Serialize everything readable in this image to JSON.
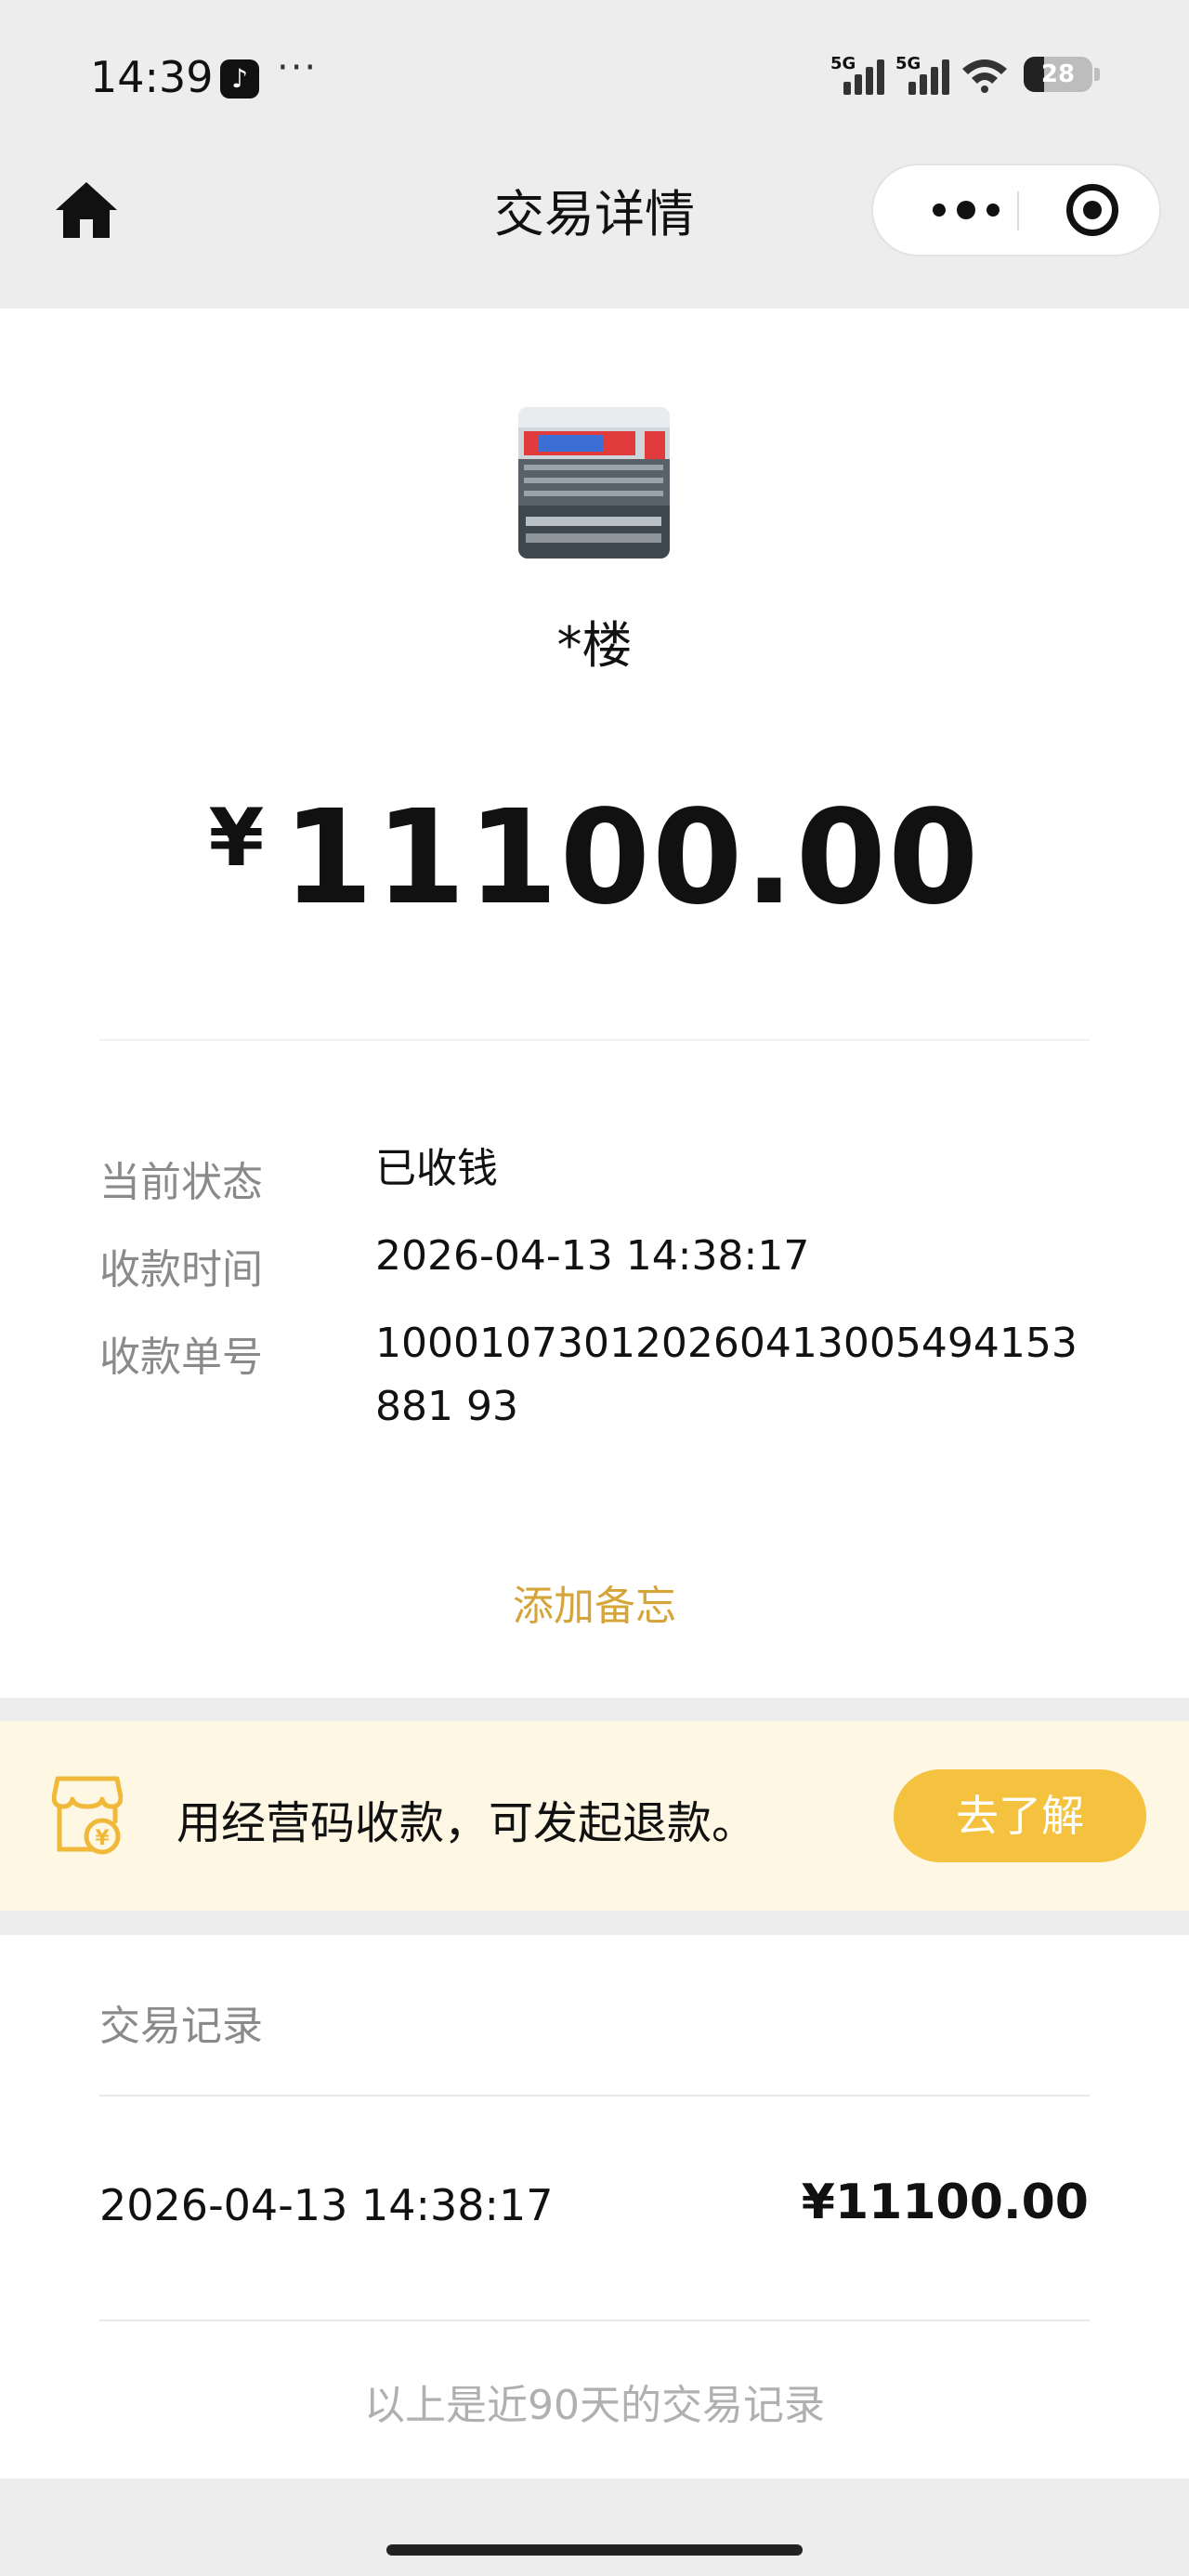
{
  "status_bar": {
    "time": "14:39",
    "app_icon": "tiktok-icon",
    "more_indicator": "···",
    "network_1": "5G",
    "network_2": "5G",
    "battery": "28"
  },
  "nav": {
    "title": "交易详情",
    "home_icon": "home-icon",
    "more_icon": "more-dots-icon",
    "close_icon": "close-target-icon"
  },
  "merchant": {
    "name": "*楼"
  },
  "amount": {
    "currency": "¥",
    "value": "11100.00"
  },
  "details": [
    {
      "label": "当前状态",
      "value": "已收钱"
    },
    {
      "label": "收款时间",
      "value": "2026-04-13 14:38:17"
    },
    {
      "label": "收款单号",
      "value": "100010730120260413005494153881 93"
    }
  ],
  "add_note": "添加备忘",
  "banner": {
    "icon": "shop-yuan-icon",
    "text": "用经营码收款，可发起退款。",
    "button": "去了解"
  },
  "records": {
    "title": "交易记录",
    "items": [
      {
        "time": "2026-04-13 14:38:17",
        "amount": "¥11100.00"
      }
    ],
    "footer": "以上是近90天的交易记录"
  },
  "colors": {
    "accent": "#f5c23f",
    "link": "#d6a53a",
    "banner_bg": "#fdf7e3",
    "page_bg": "#ededed"
  }
}
